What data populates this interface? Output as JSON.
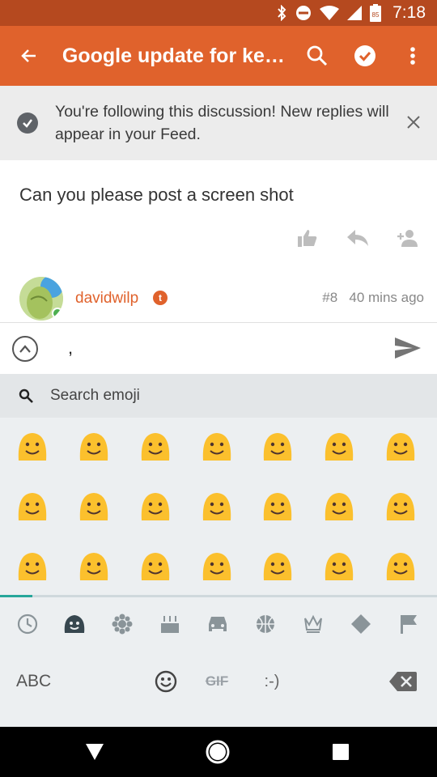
{
  "status_bar": {
    "time": "7:18",
    "battery_level": "85",
    "icons": [
      "bluetooth-icon",
      "do-not-disturb-icon",
      "wifi-icon",
      "signal-icon",
      "battery-icon"
    ]
  },
  "app_bar": {
    "title": "Google update for ke…",
    "back_icon": "back-arrow-icon",
    "actions": [
      "search-icon",
      "check-circle-icon",
      "more-vert-icon"
    ]
  },
  "banner": {
    "message": "You're following this discussion! New replies will appear in your Feed."
  },
  "post": {
    "body": "Can you please post a screen shot",
    "actions": [
      "thumbs-up-icon",
      "reply-icon",
      "add-person-icon"
    ],
    "author": {
      "name": "davidwilp",
      "badge": "t",
      "post_number": "#8",
      "time_ago": "40 mins ago"
    }
  },
  "compose": {
    "value": ","
  },
  "keyboard": {
    "search_placeholder": "Search emoji",
    "emoji": [
      "😀",
      "😁",
      "😂",
      "🤣",
      "😃",
      "😄",
      "😅",
      "😆",
      "😉",
      "😊",
      "😋",
      "😎",
      "😍",
      "😘",
      "😗",
      "😙",
      "😚",
      "🙂",
      "🙂",
      "🤗",
      "🤔"
    ],
    "categories": [
      "recent-icon",
      "smileys-icon",
      "nature-icon",
      "food-icon",
      "travel-icon",
      "activity-icon",
      "objects-icon",
      "symbols-icon",
      "flags-icon"
    ],
    "bottom": {
      "abc_label": "ABC",
      "gif_label": "GIF",
      "emoticon_label": ":-)"
    }
  },
  "colors": {
    "accent": "#e0622c",
    "status": "#b5491f",
    "teal": "#26a69a"
  }
}
